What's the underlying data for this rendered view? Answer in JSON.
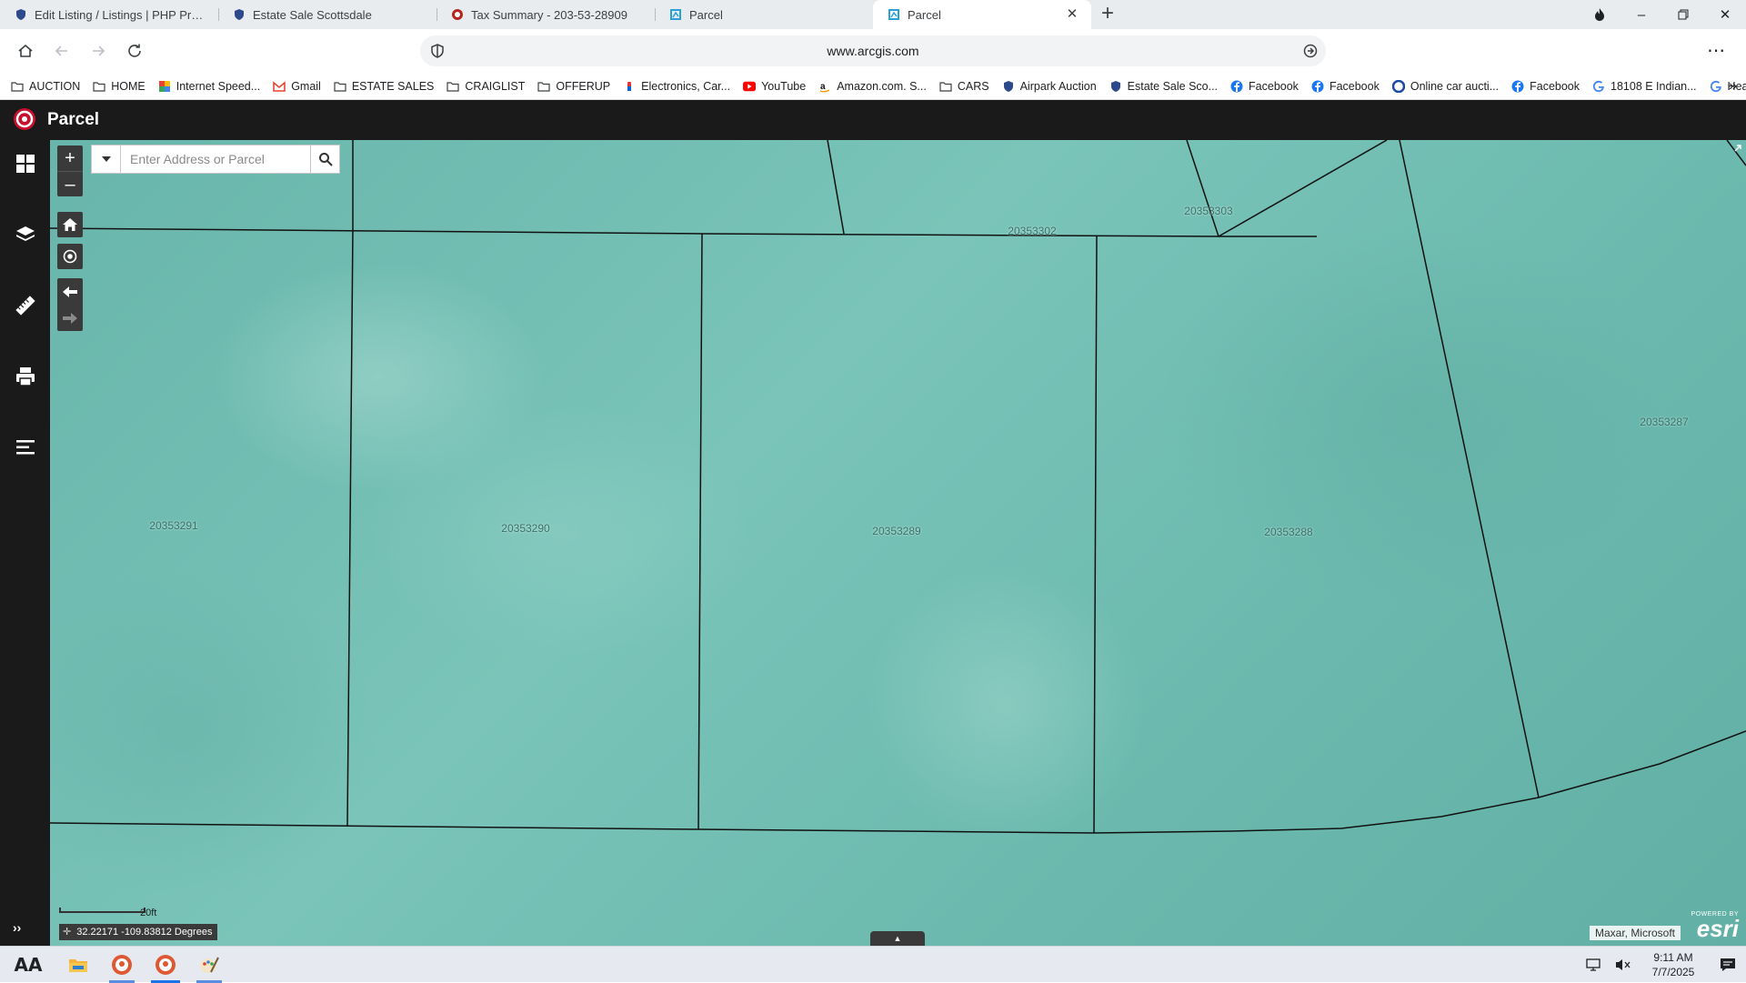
{
  "browser": {
    "tabs": [
      {
        "title": "Edit Listing / Listings | PHP Pro Bid Admin",
        "icon": "shield-favicon",
        "color": "#2c4a8a"
      },
      {
        "title": "Estate Sale Scottsdale",
        "icon": "shield-favicon",
        "color": "#2c4a8a"
      },
      {
        "title": "Tax Summary - 203-53-28909",
        "icon": "seal-favicon",
        "color": "#b3261e"
      },
      {
        "title": "Parcel",
        "icon": "arcgis-favicon",
        "color": "#2aa0d8"
      },
      {
        "title": "Parcel",
        "icon": "arcgis-favicon",
        "color": "#2aa0d8"
      }
    ],
    "active_tab": 4,
    "url": "www.arcgis.com",
    "bookmarks": [
      {
        "label": "AUCTION",
        "icon": "folder-icon"
      },
      {
        "label": "HOME",
        "icon": "folder-icon"
      },
      {
        "label": "Internet Speed...",
        "icon": "speedtest-icon"
      },
      {
        "label": "Gmail",
        "icon": "gmail-icon"
      },
      {
        "label": "ESTATE SALES",
        "icon": "folder-icon"
      },
      {
        "label": "CRAIGLIST",
        "icon": "folder-icon"
      },
      {
        "label": "OFFERUP",
        "icon": "folder-icon"
      },
      {
        "label": "Electronics, Car...",
        "icon": "ebay-icon"
      },
      {
        "label": "YouTube",
        "icon": "youtube-icon"
      },
      {
        "label": "Amazon.com. S...",
        "icon": "amazon-icon"
      },
      {
        "label": "CARS",
        "icon": "folder-icon"
      },
      {
        "label": "Airpark Auction",
        "icon": "shield-icon"
      },
      {
        "label": "Estate Sale Sco...",
        "icon": "shield-icon"
      },
      {
        "label": "Facebook",
        "icon": "facebook-icon"
      },
      {
        "label": "Facebook",
        "icon": "facebook-icon"
      },
      {
        "label": "Online car aucti...",
        "icon": "copart-icon"
      },
      {
        "label": "Facebook",
        "icon": "facebook-icon"
      },
      {
        "label": "18108 E Indian...",
        "icon": "google-icon"
      },
      {
        "label": "Healing with M...",
        "icon": "google-icon"
      }
    ]
  },
  "app": {
    "title": "Parcel",
    "search_placeholder": "Enter Address or Parcel"
  },
  "map": {
    "parcels": [
      {
        "id": "20353291"
      },
      {
        "id": "20353290"
      },
      {
        "id": "20353289"
      },
      {
        "id": "20353288"
      },
      {
        "id": "20353287"
      },
      {
        "id": "20353302"
      },
      {
        "id": "20353303"
      }
    ],
    "scale_label": "20ft",
    "coordinates": "32.22171 -109.83812 Degrees",
    "attribution": "Maxar, Microsoft",
    "esri_powered": "POWERED BY",
    "esri_name": "esri"
  },
  "taskbar": {
    "time": "9:11 AM",
    "date": "7/7/2025"
  },
  "colors": {
    "app_header": "#1a1a1a",
    "map_base": "#6bbab0",
    "parcel_line": "#111111"
  }
}
